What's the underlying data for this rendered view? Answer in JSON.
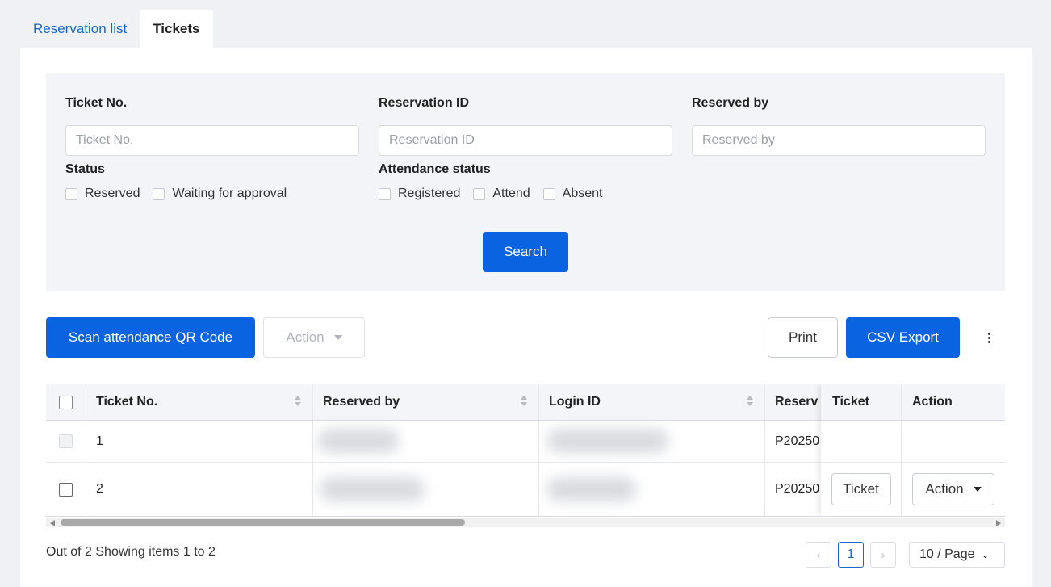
{
  "tabs": [
    {
      "label": "Reservation list",
      "active": false
    },
    {
      "label": "Tickets",
      "active": true
    }
  ],
  "filters": {
    "ticket_no": {
      "label": "Ticket No.",
      "placeholder": "Ticket No.",
      "value": ""
    },
    "reservation_id": {
      "label": "Reservation ID",
      "placeholder": "Reservation ID",
      "value": ""
    },
    "reserved_by": {
      "label": "Reserved by",
      "placeholder": "Reserved by",
      "value": ""
    },
    "status": {
      "label": "Status",
      "options": [
        {
          "label": "Reserved",
          "checked": false
        },
        {
          "label": "Waiting for approval",
          "checked": false
        }
      ]
    },
    "attendance_status": {
      "label": "Attendance status",
      "options": [
        {
          "label": "Registered",
          "checked": false
        },
        {
          "label": "Attend",
          "checked": false
        },
        {
          "label": "Absent",
          "checked": false
        }
      ]
    },
    "search_label": "Search"
  },
  "toolbar": {
    "scan_label": "Scan attendance QR Code",
    "action_label": "Action",
    "print_label": "Print",
    "csv_label": "CSV Export",
    "more_icon": "kebab-icon"
  },
  "table": {
    "columns": [
      "Ticket No.",
      "Reserved by",
      "Login ID",
      "Reserv",
      "Ticket",
      "Action"
    ],
    "rows": [
      {
        "ticket_no": "1",
        "reserved_by": "",
        "login_id": "",
        "reservation": "P20250",
        "ticket_button": "",
        "action_button": ""
      },
      {
        "ticket_no": "2",
        "reserved_by": "",
        "login_id": "",
        "reservation": "P20250",
        "ticket_button": "Ticket",
        "action_button": "Action"
      }
    ]
  },
  "footer": {
    "summary": "Out of 2 Showing items 1 to 2",
    "prev": "‹",
    "current_page": "1",
    "next": "›",
    "page_size": "10 / Page"
  },
  "colors": {
    "primary": "#0a63e0",
    "link": "#1668c4"
  }
}
